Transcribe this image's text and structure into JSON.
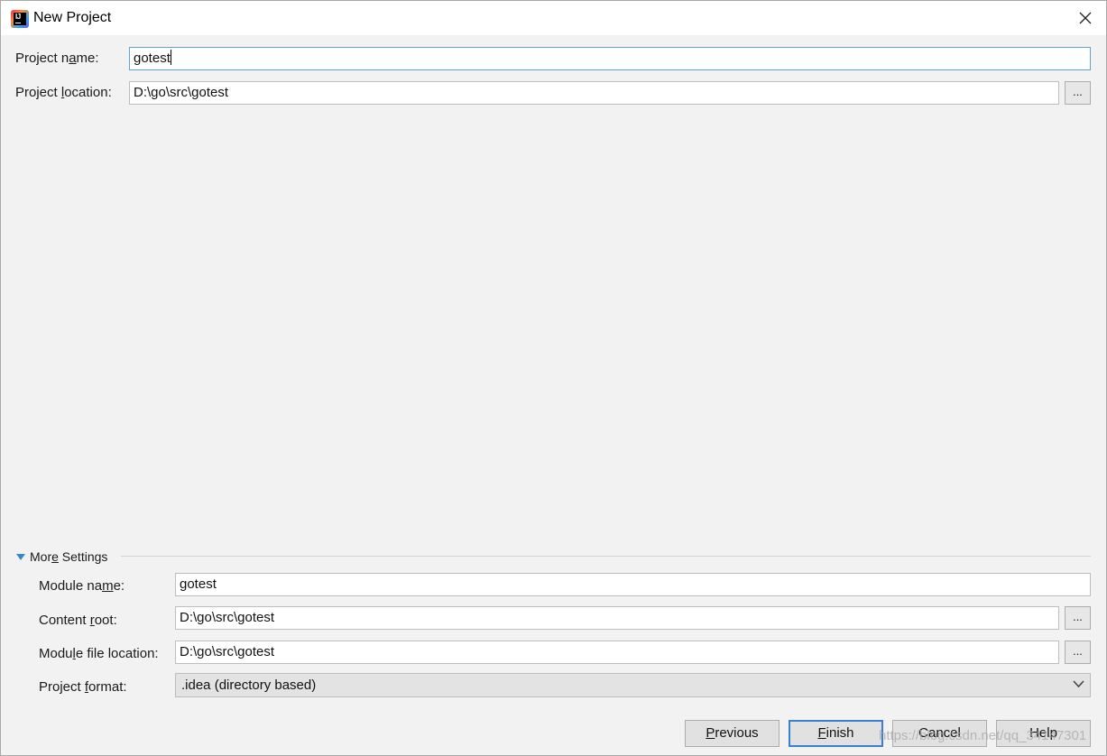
{
  "window": {
    "title": "New Project"
  },
  "project": {
    "name_label_pre": "Project n",
    "name_label_mn": "a",
    "name_label_post": "me:",
    "name_value": "gotest",
    "location_label_pre": "Project ",
    "location_label_mn": "l",
    "location_label_post": "ocation:",
    "location_value": "D:\\go\\src\\gotest",
    "browse_label": "..."
  },
  "more_settings": {
    "label_pre": "Mor",
    "label_mn": "e",
    "label_post": " Settings",
    "module_name_label_pre": "Module na",
    "module_name_label_mn": "m",
    "module_name_label_post": "e:",
    "module_name_value": "gotest",
    "content_root_label_pre": "Content ",
    "content_root_label_mn": "r",
    "content_root_label_post": "oot:",
    "content_root_value": "D:\\go\\src\\gotest",
    "module_file_label_pre": "Modu",
    "module_file_label_mn": "l",
    "module_file_label_post": "e file location:",
    "module_file_value": "D:\\go\\src\\gotest",
    "project_format_label_pre": "Project ",
    "project_format_label_mn": "f",
    "project_format_label_post": "ormat:",
    "project_format_value": ".idea (directory based)",
    "browse_label": "..."
  },
  "buttons": {
    "previous_mn": "P",
    "previous_rest": "revious",
    "finish_mn": "F",
    "finish_rest": "inish",
    "cancel": "Cancel",
    "help": "Help"
  },
  "watermark": "https://blog.csdn.net/qq_34147301"
}
